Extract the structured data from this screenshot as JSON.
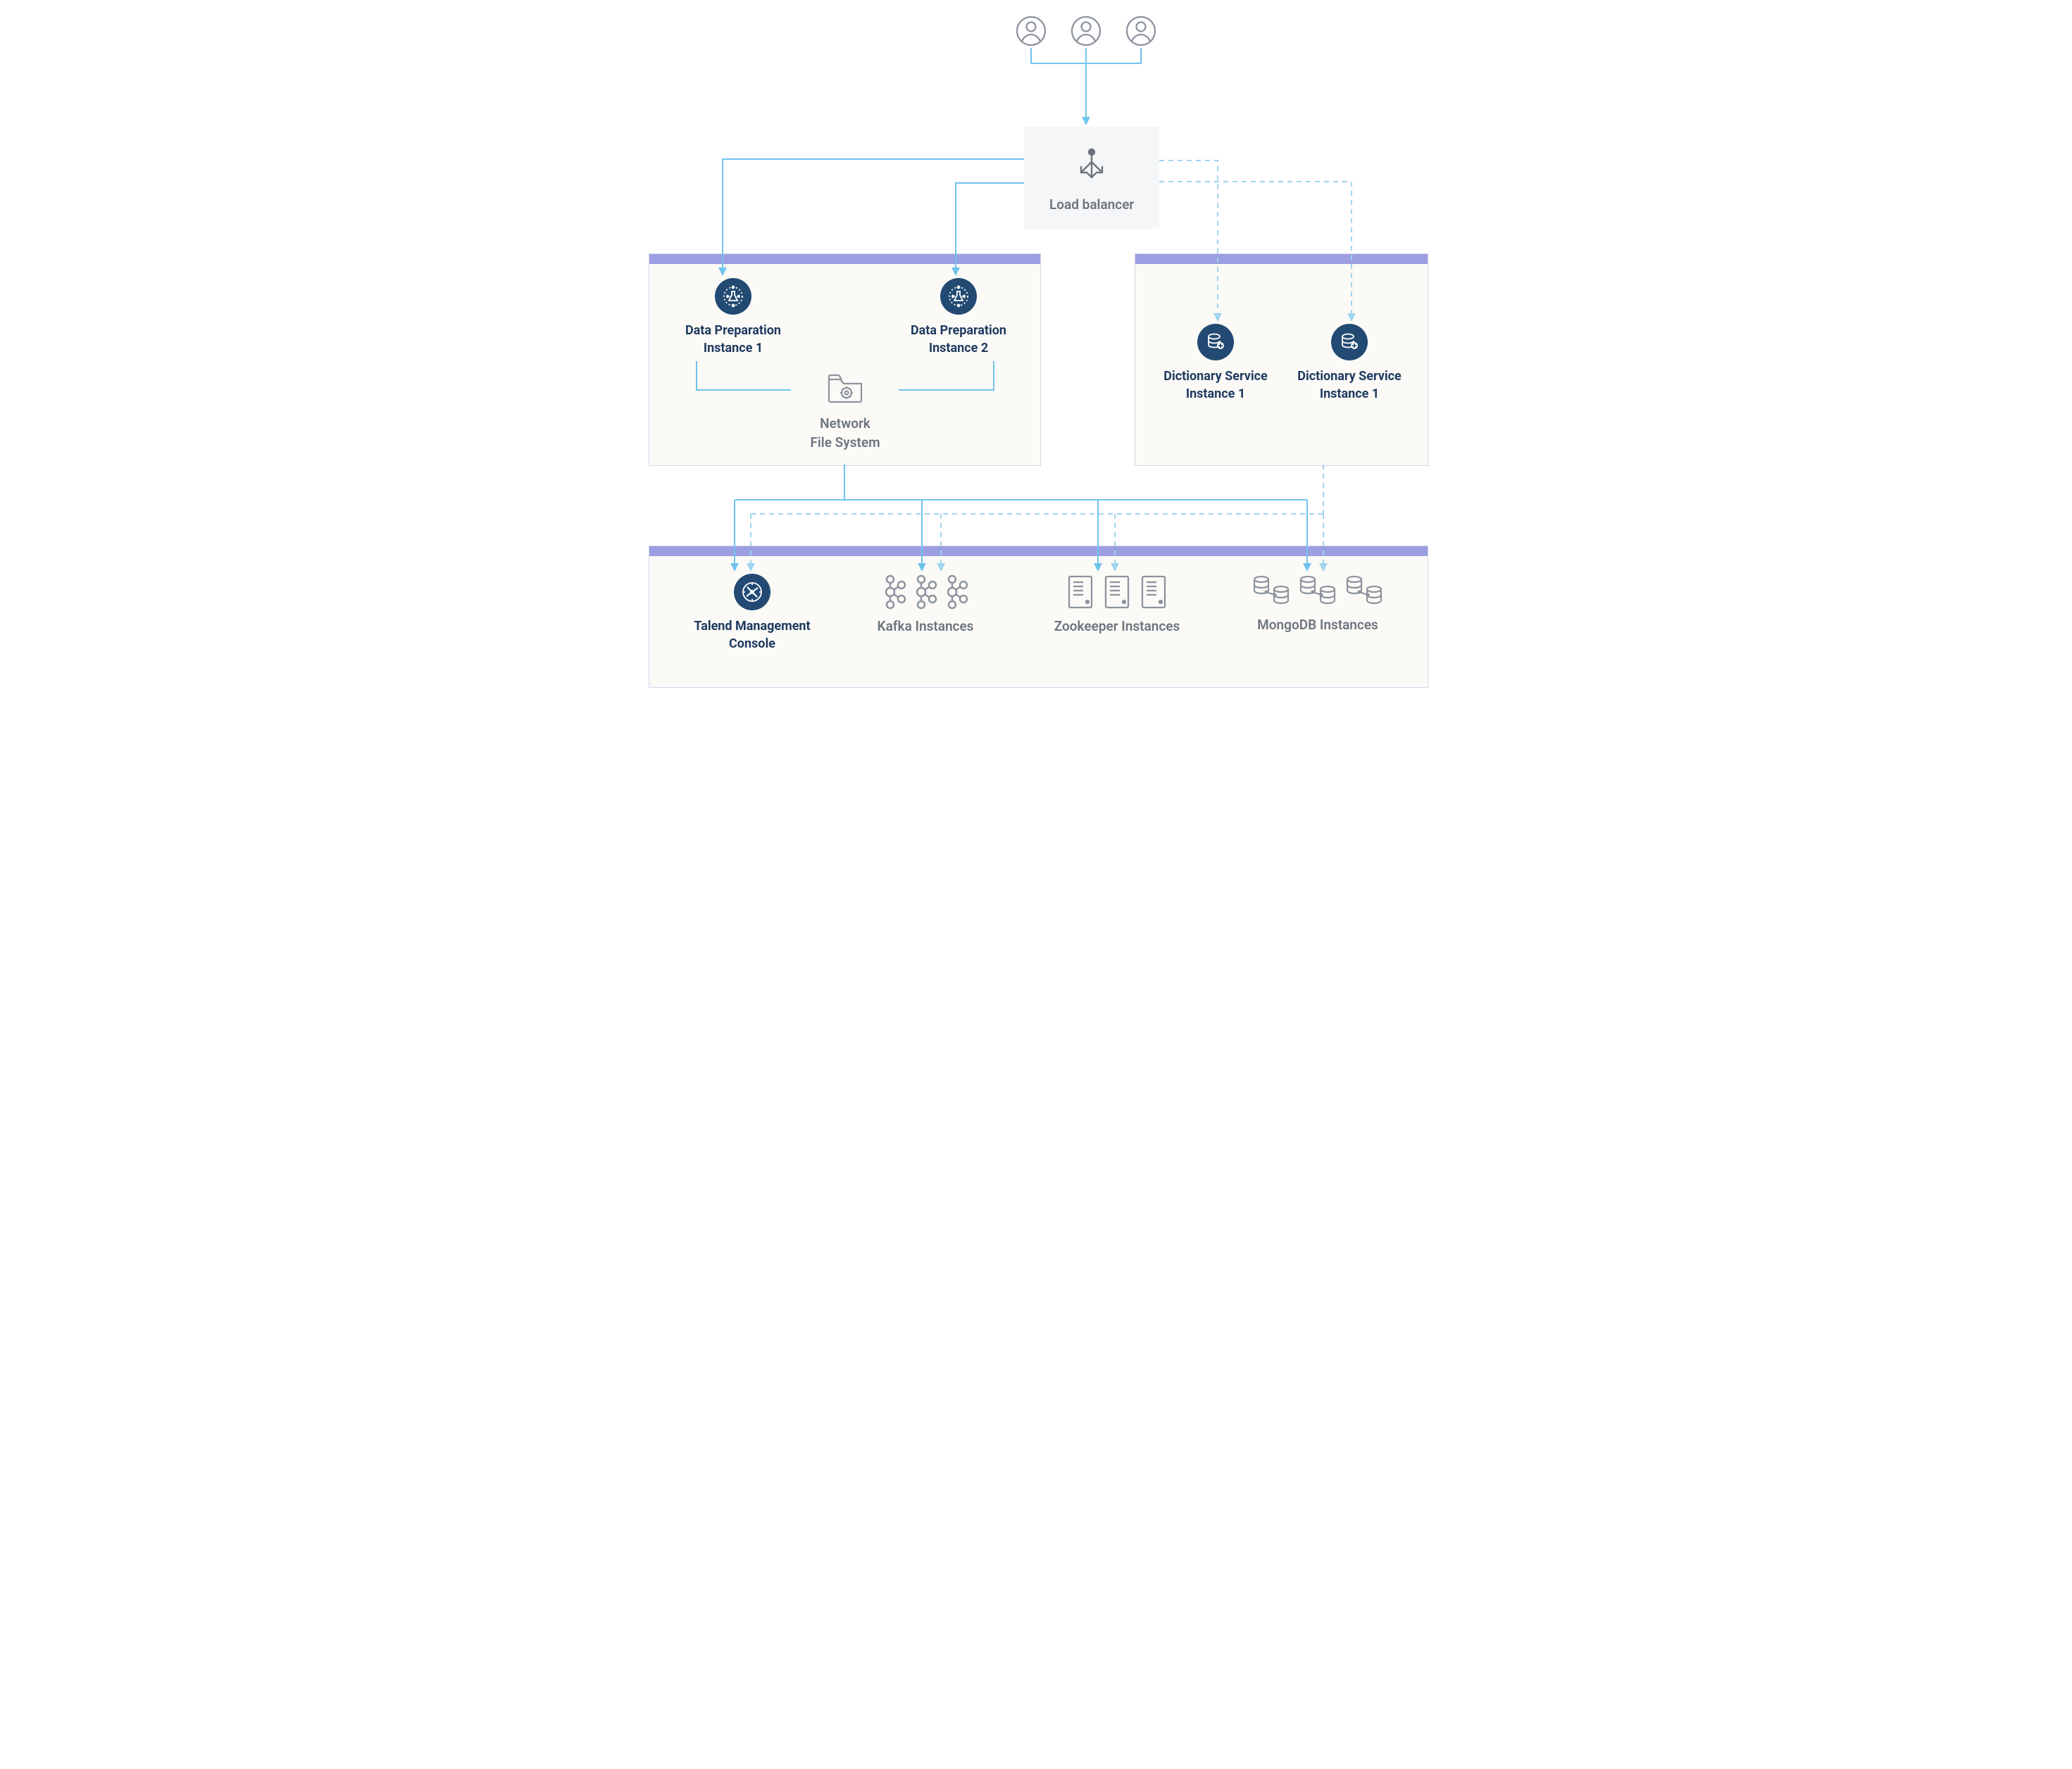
{
  "diagram": {
    "load_balancer": "Load balancer",
    "data_prep_1": [
      "Data Preparation",
      "Instance 1"
    ],
    "data_prep_2": [
      "Data Preparation",
      "Instance 2"
    ],
    "nfs": [
      "Network",
      "File System"
    ],
    "dict_1": [
      "Dictionary Service",
      "Instance 1"
    ],
    "dict_2": [
      "Dictionary Service",
      "Instance 1"
    ],
    "tmc": [
      "Talend Management",
      "Console"
    ],
    "kafka": "Kafka Instances",
    "zookeeper": "Zookeeper Instances",
    "mongodb": "MongoDB Instances",
    "colors": {
      "solid_line": "#6fc4ee",
      "dashed_line": "#9fd4ef",
      "panel_header": "#9b9ee0",
      "panel_bg": "#fbfaf7",
      "icon_dark": "#224a72",
      "gray": "#8d949e"
    },
    "layout": {
      "users_count": 3,
      "panels": [
        "data-prep",
        "dictionary",
        "backend-services"
      ],
      "connections_solid": [
        "users→load-balancer",
        "load-balancer→data-prep-1",
        "load-balancer→data-prep-2",
        "data-prep-1→nfs",
        "data-prep-2→nfs",
        "data-prep-panel→tmc",
        "data-prep-panel→kafka",
        "data-prep-panel→zookeeper",
        "data-prep-panel→mongodb"
      ],
      "connections_dashed": [
        "load-balancer→dict-1",
        "load-balancer→dict-2",
        "dict-panel→tmc",
        "dict-panel→kafka",
        "dict-panel→zookeeper",
        "dict-panel→mongodb"
      ]
    }
  }
}
